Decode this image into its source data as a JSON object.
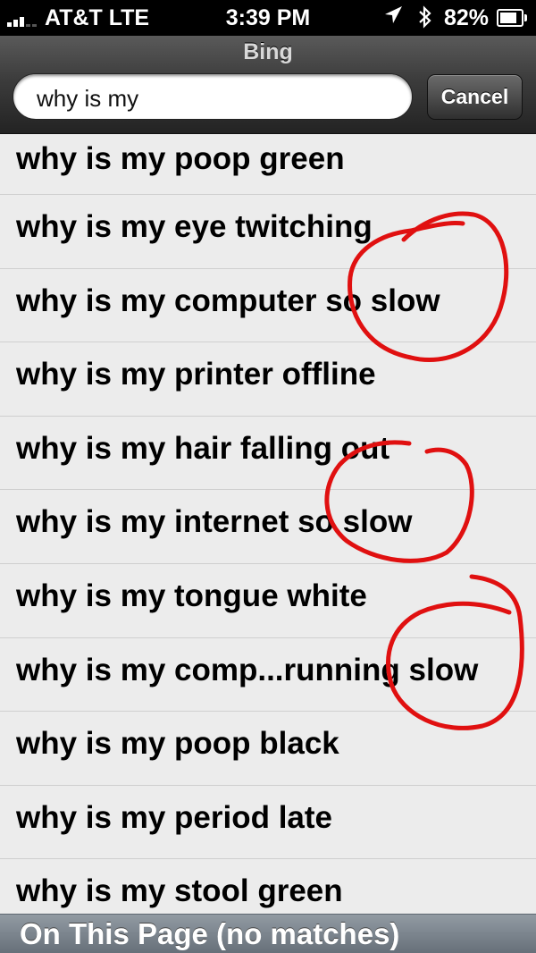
{
  "status_bar": {
    "carrier": "AT&T  LTE",
    "time": "3:39 PM",
    "battery": "82%",
    "battery_level": 0.82,
    "icons": [
      "signal-icon",
      "location-arrow-icon",
      "bluetooth-icon",
      "battery-icon"
    ]
  },
  "nav": {
    "title": "Bing",
    "search_value": "why is my",
    "cancel_label": "Cancel"
  },
  "suggestions": [
    "why is my poop green",
    "why is my eye twitching",
    "why is my computer so slow",
    "why is my printer offline",
    "why is my hair falling out",
    "why is my internet so slow",
    "why is my tongue white",
    "why is my comp...running slow",
    "why is my poop black",
    "why is my period late",
    "why is my stool green"
  ],
  "footer": {
    "text": "On This Page (no matches)"
  },
  "annotation_color": "#e01010"
}
